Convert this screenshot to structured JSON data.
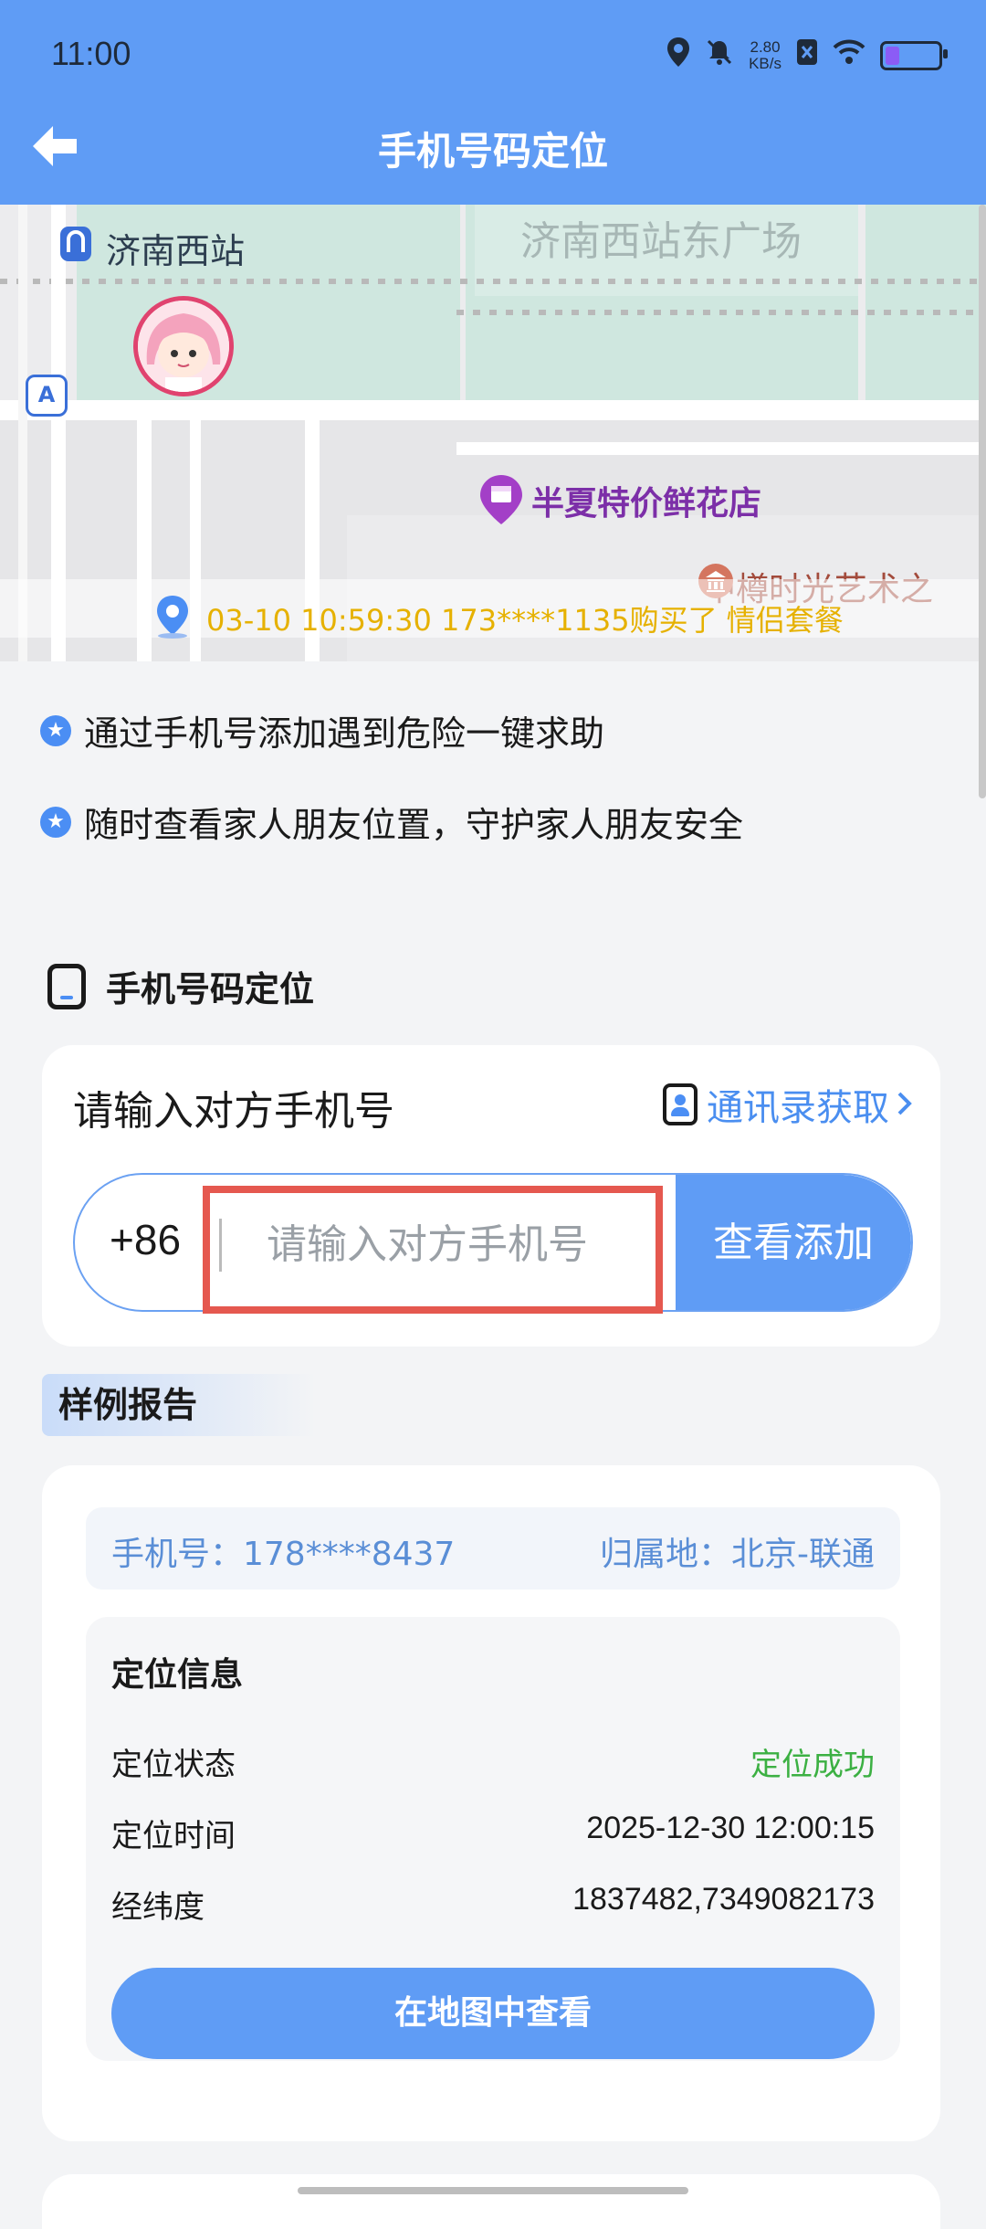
{
  "status_bar": {
    "time": "11:00",
    "net_speed_value": "2.80",
    "net_speed_unit": "KB/s",
    "battery_level_percent": 30
  },
  "header": {
    "title": "手机号码定位"
  },
  "map": {
    "station_label": "济南西站",
    "plaza_label": "济南西站东广场",
    "poi_label": "半夏特价鲜花店",
    "poi2_label": "中樽时光艺术之",
    "marker_badge": "A",
    "ticker_text": "03-10 10:59:30 173****1135购买了 情侣套餐"
  },
  "features": [
    "通过手机号添加遇到危险一键求助",
    "随时查看家人朋友位置，守护家人朋友安全"
  ],
  "section": {
    "title": "手机号码定位"
  },
  "input_card": {
    "label": "请输入对方手机号",
    "contacts_link": "通讯录获取",
    "country_code": "+86",
    "placeholder": "请输入对方手机号",
    "value": "",
    "query_button": "查看添加"
  },
  "sample": {
    "tag": "样例报告",
    "phone": "手机号：178****8437",
    "region": "归属地：北京-联通",
    "info_title": "定位信息",
    "rows": [
      {
        "label": "定位状态",
        "value": "定位成功"
      },
      {
        "label": "定位时间",
        "value": "2025-12-30 12:00:15"
      },
      {
        "label": "经纬度",
        "value": "1837482,7349082173"
      }
    ],
    "map_button": "在地图中查看"
  },
  "colors": {
    "primary": "#5f9cf5",
    "success": "#3cb043",
    "ticker": "#e6b100",
    "highlight": "#e5584f"
  }
}
